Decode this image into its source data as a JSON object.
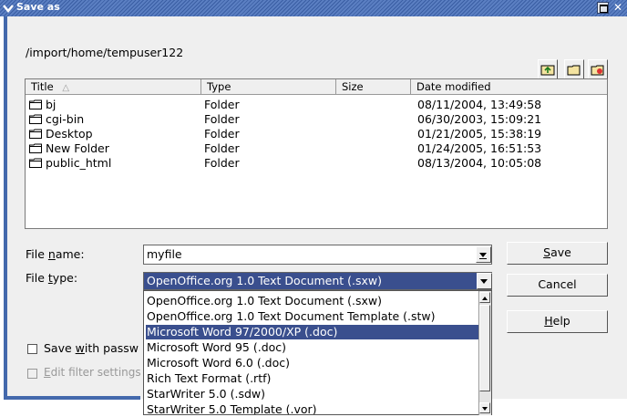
{
  "window": {
    "title": "Save as"
  },
  "path": "/import/home/tempuser122",
  "columns": {
    "title": "Title",
    "type": "Type",
    "size": "Size",
    "date": "Date modified"
  },
  "files": [
    {
      "name": "bj",
      "type": "Folder",
      "size": "",
      "date": "08/11/2004, 13:49:58"
    },
    {
      "name": "cgi-bin",
      "type": "Folder",
      "size": "",
      "date": "06/30/2003, 15:09:21"
    },
    {
      "name": "Desktop",
      "type": "Folder",
      "size": "",
      "date": "01/21/2005, 15:38:19"
    },
    {
      "name": "New Folder",
      "type": "Folder",
      "size": "",
      "date": "01/24/2005, 16:51:53"
    },
    {
      "name": "public_html",
      "type": "Folder",
      "size": "",
      "date": "08/13/2004, 10:05:08"
    }
  ],
  "filename": {
    "label_pre": "File ",
    "label_ul": "n",
    "label_post": "ame:",
    "value": "myfile"
  },
  "filetype": {
    "label_pre": "File ",
    "label_ul": "t",
    "label_post": "ype:",
    "value": "OpenOffice.org 1.0 Text Document (.sxw)"
  },
  "options": [
    "OpenOffice.org 1.0 Text Document (.sxw)",
    "OpenOffice.org 1.0 Text Document Template (.stw)",
    "Microsoft Word 97/2000/XP (.doc)",
    "Microsoft Word 95 (.doc)",
    "Microsoft Word 6.0 (.doc)",
    "Rich Text Format (.rtf)",
    "StarWriter 5.0 (.sdw)",
    "StarWriter 5.0 Template (.vor)"
  ],
  "buttons": {
    "save_ul": "S",
    "save_rest": "ave",
    "cancel": "Cancel",
    "help_ul": "H",
    "help_rest": "elp"
  },
  "checkboxes": {
    "password_pre": "Save ",
    "password_ul": "w",
    "password_post": "ith passw",
    "filter_ul": "E",
    "filter_rest": "dit filter settings"
  },
  "colors": {
    "selection": "#3a4f8e",
    "titlebar": "#4469ac"
  }
}
